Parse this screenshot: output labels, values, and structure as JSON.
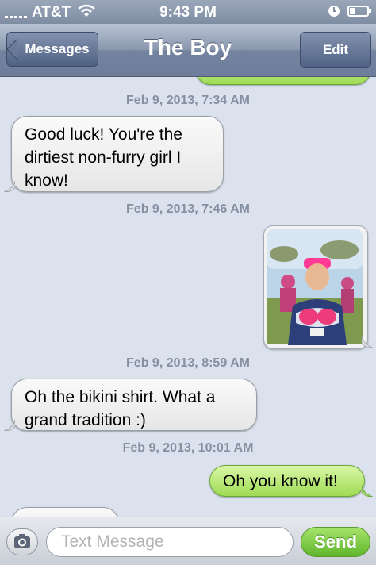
{
  "status_bar": {
    "signal_icon": "signal-bars-icon",
    "carrier": "AT&T",
    "wifi_icon": "wifi-icon",
    "time": "9:43 PM",
    "alarm_icon": "alarm-clock-icon",
    "battery_icon": "battery-icon"
  },
  "nav": {
    "back_label": "Messages",
    "title": "The Boy",
    "edit_label": "Edit"
  },
  "thread": {
    "timestamps": [
      "Feb 9, 2013, 7:34 AM",
      "Feb 9, 2013, 7:46 AM",
      "Feb 9, 2013, 8:59 AM",
      "Feb 9, 2013, 10:01 AM"
    ],
    "messages": [
      {
        "direction": "incoming",
        "text": "Good luck! You're the dirtiest non-furry girl I know!"
      },
      {
        "direction": "outgoing",
        "type": "photo",
        "photo_icon": "photo-thumbnail-icon"
      },
      {
        "direction": "incoming",
        "text": "Oh the bikini shirt. What a grand tradition :)"
      },
      {
        "direction": "outgoing",
        "text": "Oh you know it!"
      }
    ]
  },
  "compose": {
    "camera_icon": "camera-icon",
    "placeholder": "Text Message",
    "send_label": "Send"
  },
  "colors": {
    "incoming_bubble": "#ececec",
    "outgoing_bubble": "#b5e67c",
    "nav_bar": "#7f8da5",
    "background": "#dbe2ed"
  }
}
